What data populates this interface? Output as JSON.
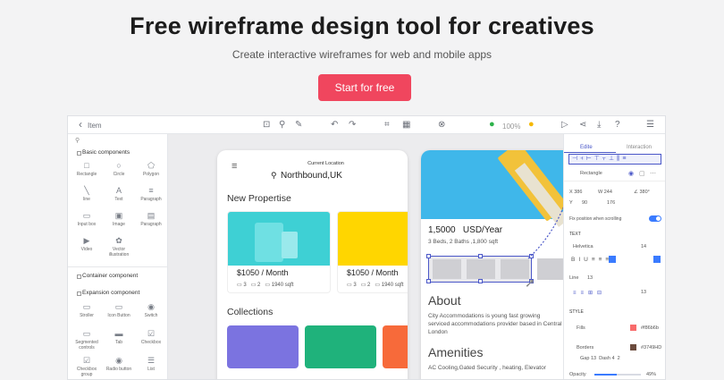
{
  "hero": {
    "title": "Free wireframe design tool for creatives",
    "subtitle": "Create interactive wireframes for web and mobile apps",
    "cta": "Start for free"
  },
  "toolbar": {
    "back": "‹",
    "back_label": "Item",
    "zoom": "100%"
  },
  "left_panel": {
    "sections": [
      "Basic components",
      "Container component",
      "Expansion component"
    ],
    "basic": [
      {
        "label": "Rectangle",
        "icon": "□"
      },
      {
        "label": "Circle",
        "icon": "○"
      },
      {
        "label": "Polygon",
        "icon": "⬠"
      },
      {
        "label": "line",
        "icon": "╲"
      },
      {
        "label": "Text",
        "icon": "A"
      },
      {
        "label": "Paragraph",
        "icon": "≡"
      },
      {
        "label": "Input box",
        "icon": "▭"
      },
      {
        "label": "Image",
        "icon": "▣"
      },
      {
        "label": "Paragraph",
        "icon": "▤"
      },
      {
        "label": "Video",
        "icon": "▶"
      },
      {
        "label": "Vector illustration",
        "icon": "✿"
      }
    ],
    "expansion": [
      {
        "label": "Stroller",
        "icon": "▭"
      },
      {
        "label": "Icon Button",
        "icon": "▭"
      },
      {
        "label": "Switch",
        "icon": "◉"
      },
      {
        "label": "Segmented controls",
        "icon": "▭"
      },
      {
        "label": "Tab",
        "icon": "▬"
      },
      {
        "label": "Checkbox",
        "icon": "☑"
      },
      {
        "label": "Checkbox group",
        "icon": "☑"
      },
      {
        "label": "Radio button",
        "icon": "◉"
      },
      {
        "label": "List",
        "icon": "☰"
      }
    ]
  },
  "phone1": {
    "location_label": "Current Location",
    "location": "Northbound,UK",
    "section1": "New Propertise",
    "cards": [
      {
        "price": "$1050 / Month",
        "beds": "3",
        "baths": "2",
        "area": "1940 sqft",
        "color": "#3ed0d4"
      },
      {
        "price": "$1050 / Month",
        "beds": "3",
        "baths": "2",
        "area": "1940 sqft",
        "color": "#ffd600"
      }
    ],
    "section2": "Collections",
    "collections": [
      "#7b73e0",
      "#1fb27b",
      "#f76a3a"
    ]
  },
  "phone2": {
    "price": "1,5000   USD/Year",
    "details": "3 Beds, 2 Baths ,1,800 sqft",
    "about_title": "About",
    "about_text": "City Accommodations  is young fast growing serviced accommodations provider based in Central London",
    "amenities_title": "Amenities",
    "amenities_text": "AC Cooling,Gated Security , heating, Elevator"
  },
  "right_panel": {
    "tabs": [
      "Edite",
      "Interaction"
    ],
    "shape": "Rectangle",
    "x": "386",
    "y": "",
    "w": "244",
    "h": "380°",
    "r": "90",
    "l": "176",
    "fix_label": "Fix position when scrolling",
    "text_label": "TEXT",
    "font": "Helvetica",
    "font_size": "14",
    "line_label": "Line",
    "line_value": "13",
    "spacing_value": "13",
    "style_label": "STYLE",
    "fills_label": "Fills",
    "fills_color": "#f86b6b",
    "fills_hex": "#f86b6b",
    "borders_label": "Borders",
    "borders_color": "#6b4b3d",
    "borders_hex": "#3749HD",
    "gap_label": "Gap",
    "gap_value": "13",
    "dash_label": "Dash",
    "dash_a": "4",
    "dash_b": "2",
    "opacity_label": "Opacity",
    "opacity_value": "49%"
  }
}
